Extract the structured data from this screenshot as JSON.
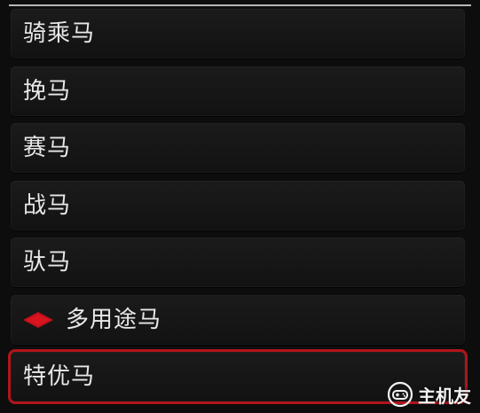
{
  "menu": {
    "items": [
      {
        "label": "骑乘马"
      },
      {
        "label": "挽马"
      },
      {
        "label": "赛马"
      },
      {
        "label": "战马"
      },
      {
        "label": "驮马"
      },
      {
        "label": "多用途马",
        "marker": "red-diamond-icon"
      },
      {
        "label": "特优马",
        "selected": true
      }
    ]
  },
  "colors": {
    "selection": "#b1141a",
    "marker": "#c0101c",
    "text": "#e8e8e8",
    "background": "#0d0d0d"
  },
  "watermark": {
    "text": "主机友",
    "icon": "gamepad-icon"
  }
}
